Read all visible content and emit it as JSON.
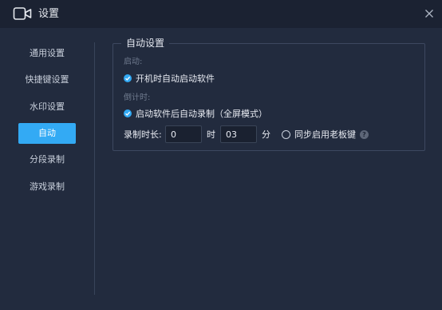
{
  "window": {
    "title": "设置",
    "icon": "video-camera-icon",
    "close_icon": "close-icon"
  },
  "sidebar": {
    "items": [
      {
        "label": "通用设置",
        "active": false
      },
      {
        "label": "快捷键设置",
        "active": false
      },
      {
        "label": "水印设置",
        "active": false
      },
      {
        "label": "自动",
        "active": true
      },
      {
        "label": "分段录制",
        "active": false
      },
      {
        "label": "游戏录制",
        "active": false
      }
    ]
  },
  "auto_settings": {
    "legend": "自动设置",
    "startup": {
      "label": "启动:",
      "option_label": "开机时自动启动软件",
      "checked": true
    },
    "countdown": {
      "label": "倒计时:",
      "option_label": "启动软件后自动录制（全屏模式）",
      "checked": true
    },
    "duration": {
      "label": "录制时长:",
      "hours_value": "0",
      "hours_unit": "时",
      "minutes_value": "03",
      "minutes_unit": "分"
    },
    "sync_boss_key": {
      "label": "同步启用老板键",
      "selected": false,
      "help_icon": "question-icon",
      "help_glyph": "?"
    }
  },
  "colors": {
    "accent": "#33aaf4",
    "background": "#222b3e",
    "titlebar": "#1b2232"
  }
}
